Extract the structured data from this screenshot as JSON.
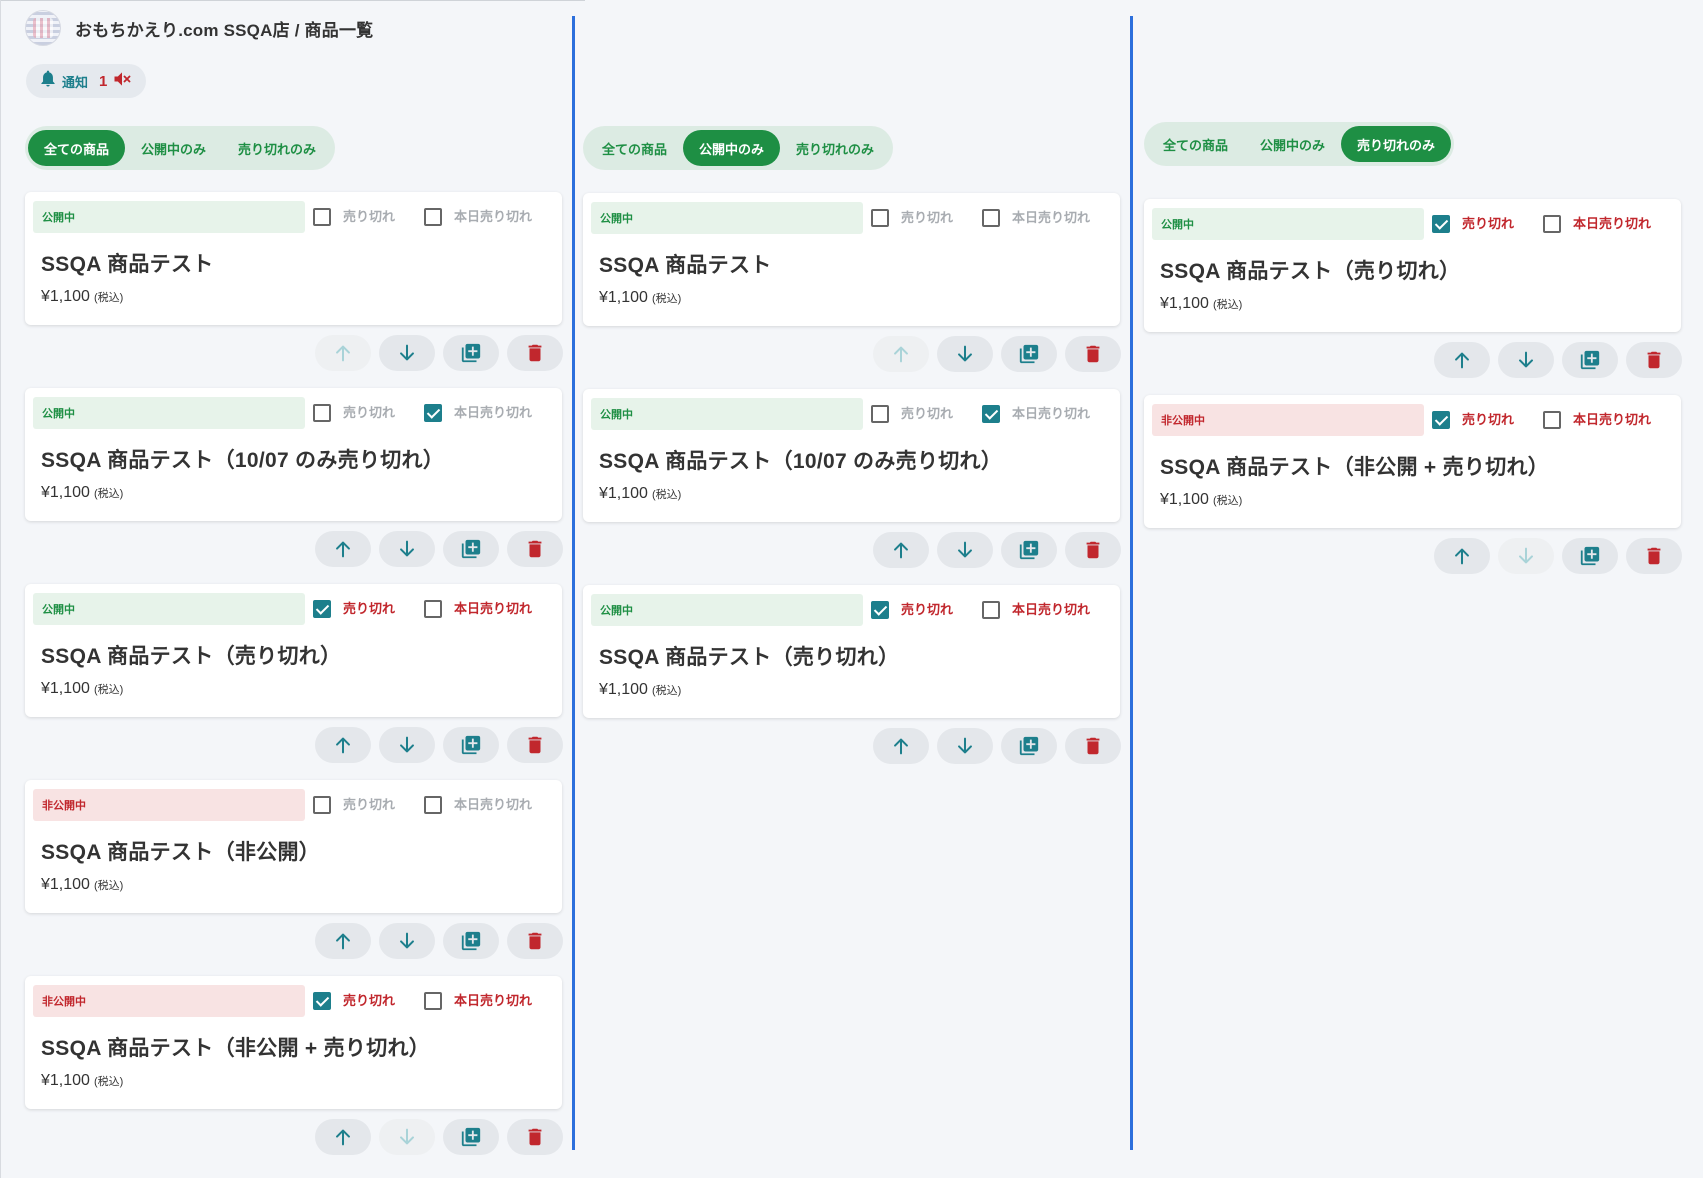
{
  "header": {
    "title": "おもちかえり.com SSQA店 / 商品一覧"
  },
  "notification": {
    "label": "通知",
    "count": "1"
  },
  "labels": {
    "sold_out": "売り切れ",
    "today_sold_out": "本日売り切れ",
    "tax_note": "(税込)"
  },
  "colors": {
    "accent_green": "#1e8f44",
    "teal": "#1d7f8c",
    "danger_red": "#c1272d",
    "divider_blue": "#2c6fdc"
  },
  "columns": [
    {
      "filters": [
        {
          "label": "全ての商品",
          "active": true
        },
        {
          "label": "公開中のみ",
          "active": false
        },
        {
          "label": "売り切れのみ",
          "active": false
        }
      ],
      "products": [
        {
          "status": "公開中",
          "public": true,
          "sold_out": false,
          "today_sold_out": false,
          "name": "SSQA 商品テスト",
          "price": "¥1,100",
          "up_enabled": false,
          "down_enabled": true
        },
        {
          "status": "公開中",
          "public": true,
          "sold_out": false,
          "today_sold_out": true,
          "name": "SSQA 商品テスト（10/07 のみ売り切れ）",
          "price": "¥1,100",
          "up_enabled": true,
          "down_enabled": true
        },
        {
          "status": "公開中",
          "public": true,
          "sold_out": true,
          "today_sold_out": false,
          "name": "SSQA 商品テスト（売り切れ）",
          "price": "¥1,100",
          "up_enabled": true,
          "down_enabled": true
        },
        {
          "status": "非公開中",
          "public": false,
          "sold_out": false,
          "today_sold_out": false,
          "name": "SSQA 商品テスト（非公開）",
          "price": "¥1,100",
          "up_enabled": true,
          "down_enabled": true
        },
        {
          "status": "非公開中",
          "public": false,
          "sold_out": true,
          "today_sold_out": false,
          "name": "SSQA 商品テスト（非公開 + 売り切れ）",
          "price": "¥1,100",
          "up_enabled": true,
          "down_enabled": false
        }
      ]
    },
    {
      "filters": [
        {
          "label": "全ての商品",
          "active": false
        },
        {
          "label": "公開中のみ",
          "active": true
        },
        {
          "label": "売り切れのみ",
          "active": false
        }
      ],
      "products": [
        {
          "status": "公開中",
          "public": true,
          "sold_out": false,
          "today_sold_out": false,
          "name": "SSQA 商品テスト",
          "price": "¥1,100",
          "up_enabled": false,
          "down_enabled": true
        },
        {
          "status": "公開中",
          "public": true,
          "sold_out": false,
          "today_sold_out": true,
          "name": "SSQA 商品テスト（10/07 のみ売り切れ）",
          "price": "¥1,100",
          "up_enabled": true,
          "down_enabled": true
        },
        {
          "status": "公開中",
          "public": true,
          "sold_out": true,
          "today_sold_out": false,
          "name": "SSQA 商品テスト（売り切れ）",
          "price": "¥1,100",
          "up_enabled": true,
          "down_enabled": true
        }
      ]
    },
    {
      "filters": [
        {
          "label": "全ての商品",
          "active": false
        },
        {
          "label": "公開中のみ",
          "active": false
        },
        {
          "label": "売り切れのみ",
          "active": true
        }
      ],
      "products": [
        {
          "status": "公開中",
          "public": true,
          "sold_out": true,
          "today_sold_out": false,
          "name": "SSQA 商品テスト（売り切れ）",
          "price": "¥1,100",
          "up_enabled": true,
          "down_enabled": true
        },
        {
          "status": "非公開中",
          "public": false,
          "sold_out": true,
          "today_sold_out": false,
          "name": "SSQA 商品テスト（非公開 + 売り切れ）",
          "price": "¥1,100",
          "up_enabled": true,
          "down_enabled": false
        }
      ]
    }
  ]
}
